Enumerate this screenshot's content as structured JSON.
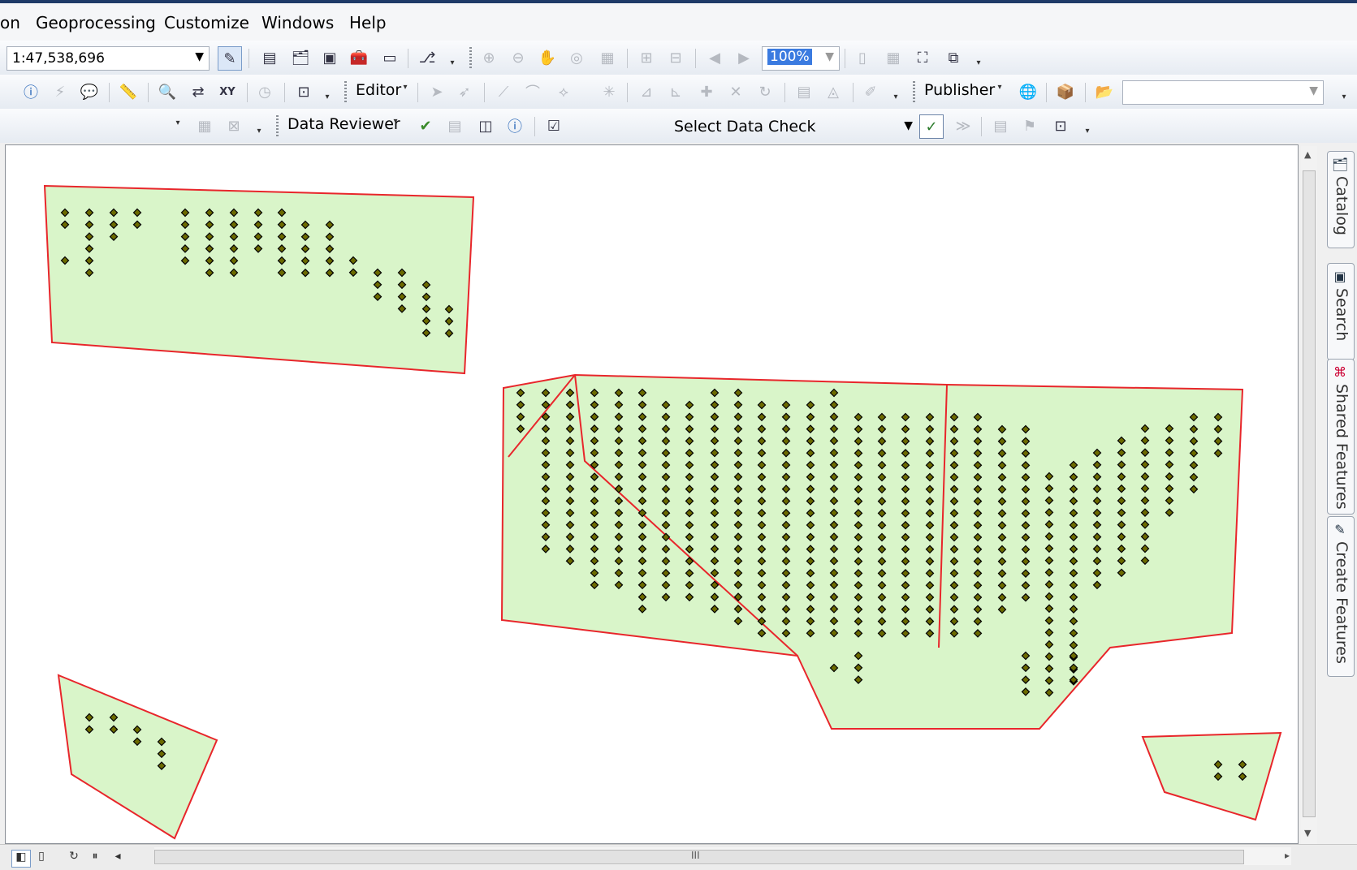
{
  "menu": {
    "items": [
      "on",
      "Geoprocessing",
      "Customize",
      "Windows",
      "Help"
    ]
  },
  "standard_toolbar": {
    "scale_value": "1:47,538,696",
    "zoom_value": "100%"
  },
  "editor_toolbar": {
    "editor_label": "Editor",
    "publisher_label": "Publisher"
  },
  "reviewer_toolbar": {
    "data_reviewer_label": "Data Reviewer",
    "data_check_value": "Select Data Check"
  },
  "side_tabs": [
    "Catalog",
    "Search",
    "Shared Features",
    "Create Features"
  ],
  "status_bar": {
    "scroll_mark": "III"
  },
  "map": {
    "polygon_fill": "#d9f5c9",
    "polygon_stroke": "#e8262b",
    "point_fill": "#6b6a00",
    "point_stroke": "#000000"
  }
}
